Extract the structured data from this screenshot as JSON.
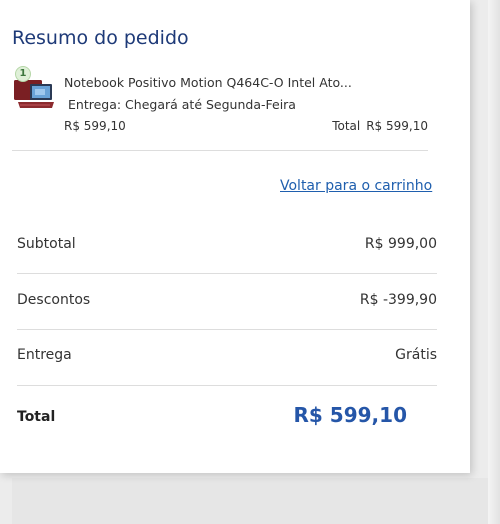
{
  "summary": {
    "title": "Resumo do pedido",
    "item": {
      "quantity": "1",
      "name": "Notebook Positivo Motion Q464C-O Intel Ato...",
      "delivery": "Entrega: Chegará até Segunda-Feira",
      "price": "R$ 599,10",
      "total_label": "Total",
      "total_value": "R$ 599,10",
      "thumbnail_icon": "laptop-icon"
    },
    "back_link": "Voltar para o carrinho",
    "rows": [
      {
        "label": "Subtotal",
        "value": "R$ 999,00"
      },
      {
        "label": "Descontos",
        "value": "R$ -399,90"
      },
      {
        "label": "Entrega",
        "value": "Grátis"
      }
    ],
    "total": {
      "label": "Total",
      "value": "R$ 599,10"
    }
  },
  "colors": {
    "title": "#1e3a78",
    "link": "#1f5fae",
    "total_value": "#2556a8",
    "badge_bg": "#dff0d8",
    "laptop_body": "#7a1f23"
  }
}
